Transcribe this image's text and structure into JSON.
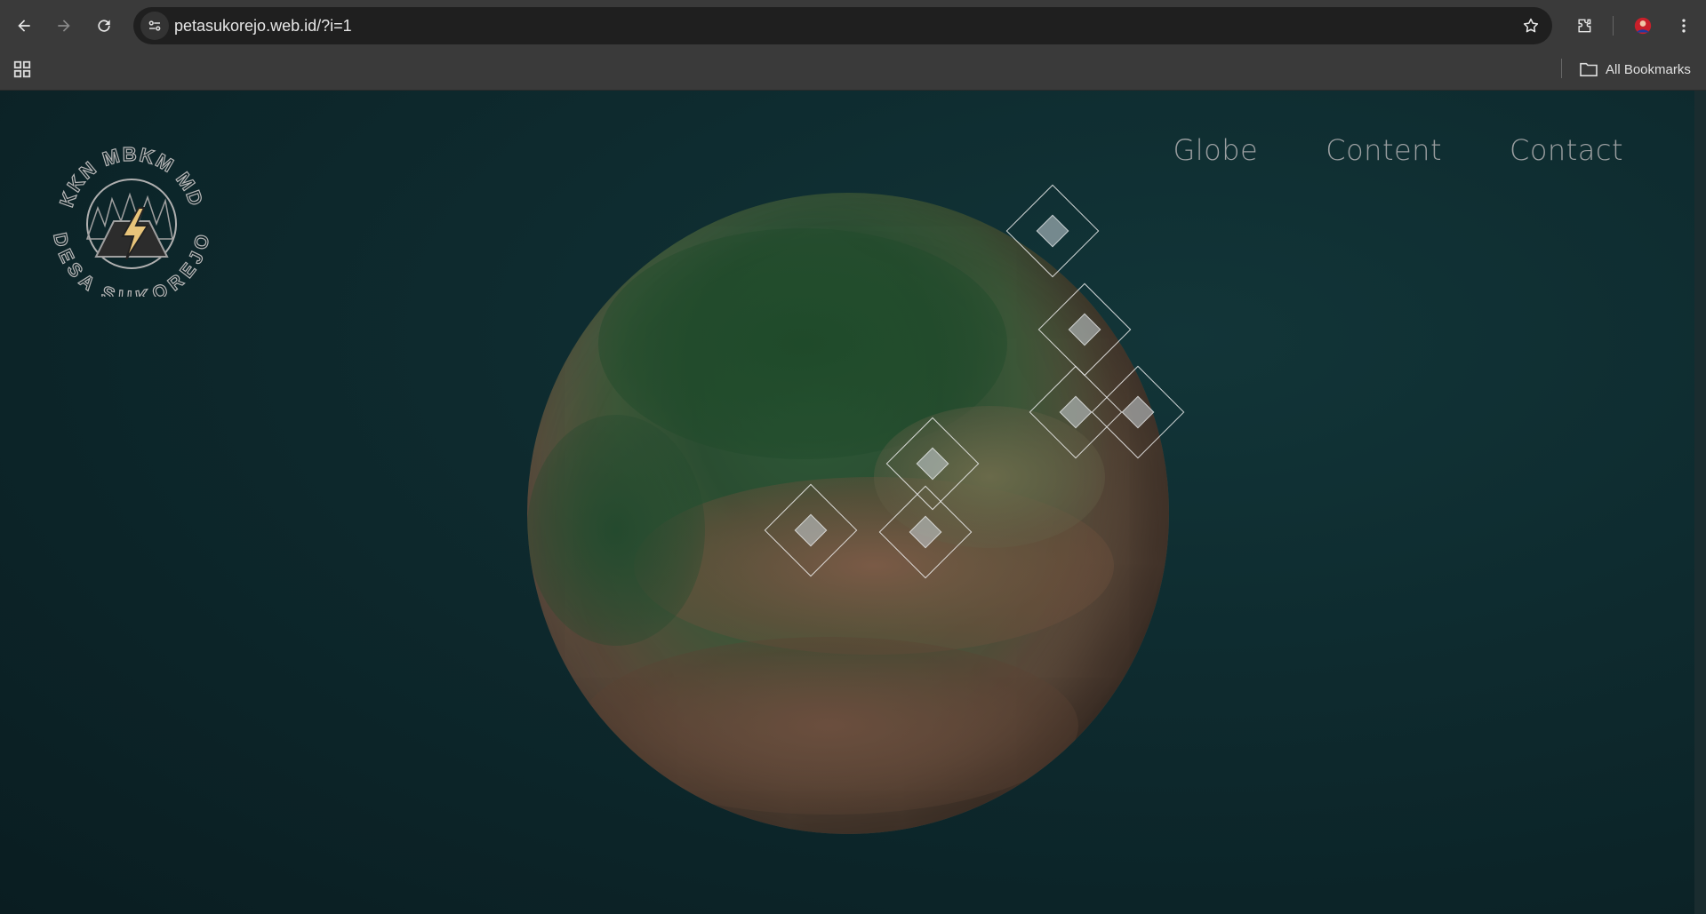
{
  "browser": {
    "url": "petasukorejo.web.id/?i=1",
    "bookmarks_label": "All Bookmarks",
    "icons": [
      "back-icon",
      "forward-icon",
      "reload-icon",
      "site-info-icon",
      "star-icon",
      "extensions-icon",
      "profile-avatar",
      "more-icon",
      "apps-icon",
      "folder-icon"
    ]
  },
  "site": {
    "nav": {
      "globe": "Globe",
      "content": "Content",
      "contact": "Contact"
    },
    "logo": {
      "top_text": "KKN MBKM MD",
      "bottom_text": "DESA SUKOREJO"
    },
    "globe_markers": 7
  },
  "colors": {
    "page_bg": "#0d2124",
    "nav_text": "#9a9ea0",
    "chrome_bg": "#3a3a3a"
  }
}
